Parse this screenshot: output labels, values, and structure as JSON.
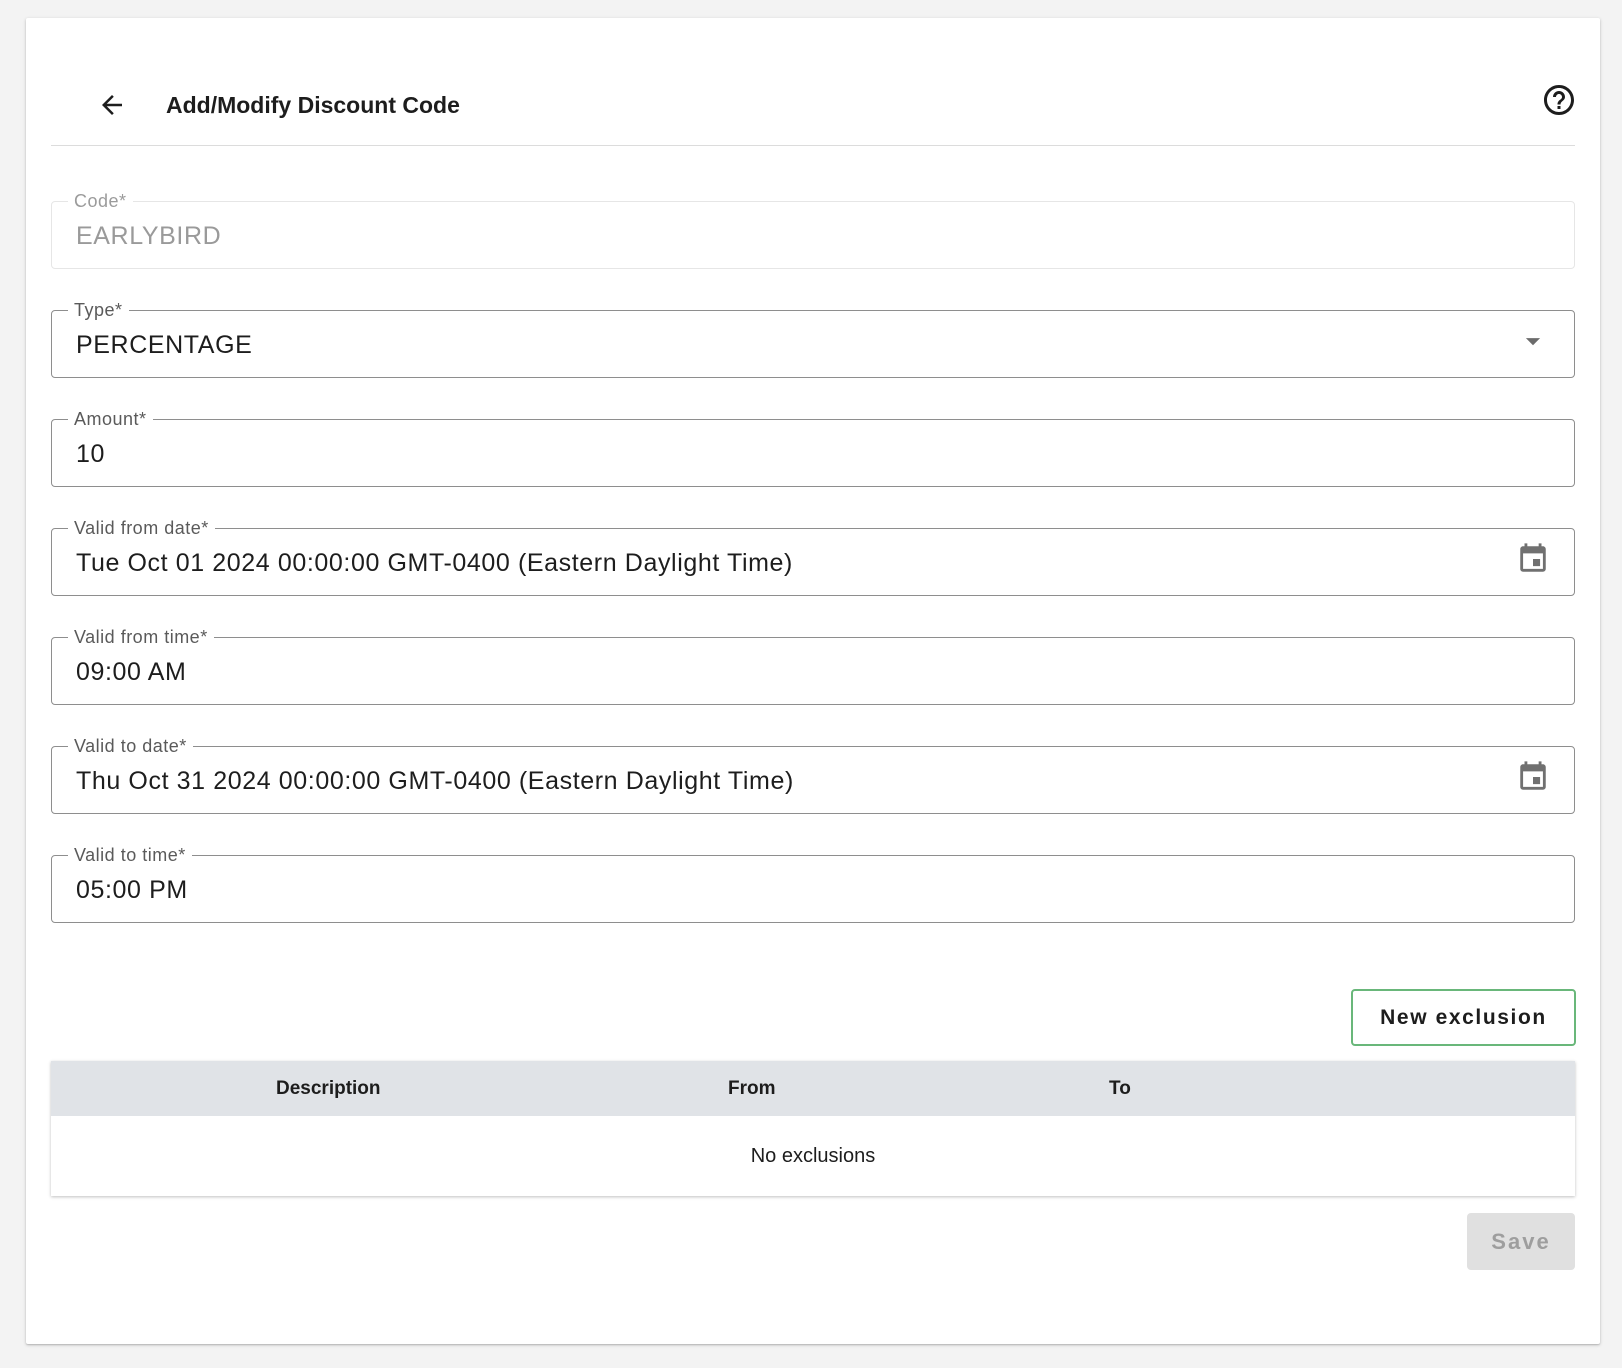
{
  "header": {
    "title": "Add/Modify Discount Code",
    "back_icon": "arrow-back-icon",
    "help_icon": "help-circle-icon"
  },
  "form": {
    "code": {
      "label": "Code*",
      "value": "EARLYBIRD",
      "disabled": true
    },
    "type": {
      "label": "Type*",
      "value": "PERCENTAGE"
    },
    "amount": {
      "label": "Amount*",
      "value": "10"
    },
    "valid_from_date": {
      "label": "Valid from date*",
      "value": "Tue Oct 01 2024 00:00:00 GMT-0400 (Eastern Daylight Time)"
    },
    "valid_from_time": {
      "label": "Valid from time*",
      "value": "09:00 AM"
    },
    "valid_to_date": {
      "label": "Valid to date*",
      "value": "Thu Oct 31 2024 00:00:00 GMT-0400 (Eastern Daylight Time)"
    },
    "valid_to_time": {
      "label": "Valid to time*",
      "value": "05:00 PM"
    }
  },
  "exclusions": {
    "new_button_label": "New exclusion",
    "columns": [
      "Description",
      "From",
      "To"
    ],
    "empty_text": "No exclusions"
  },
  "actions": {
    "save_label": "Save"
  },
  "colors": {
    "accent_outline": "#69b77a",
    "table_header_bg": "#e0e3e7",
    "disabled_button_bg": "#e0e0e0"
  }
}
